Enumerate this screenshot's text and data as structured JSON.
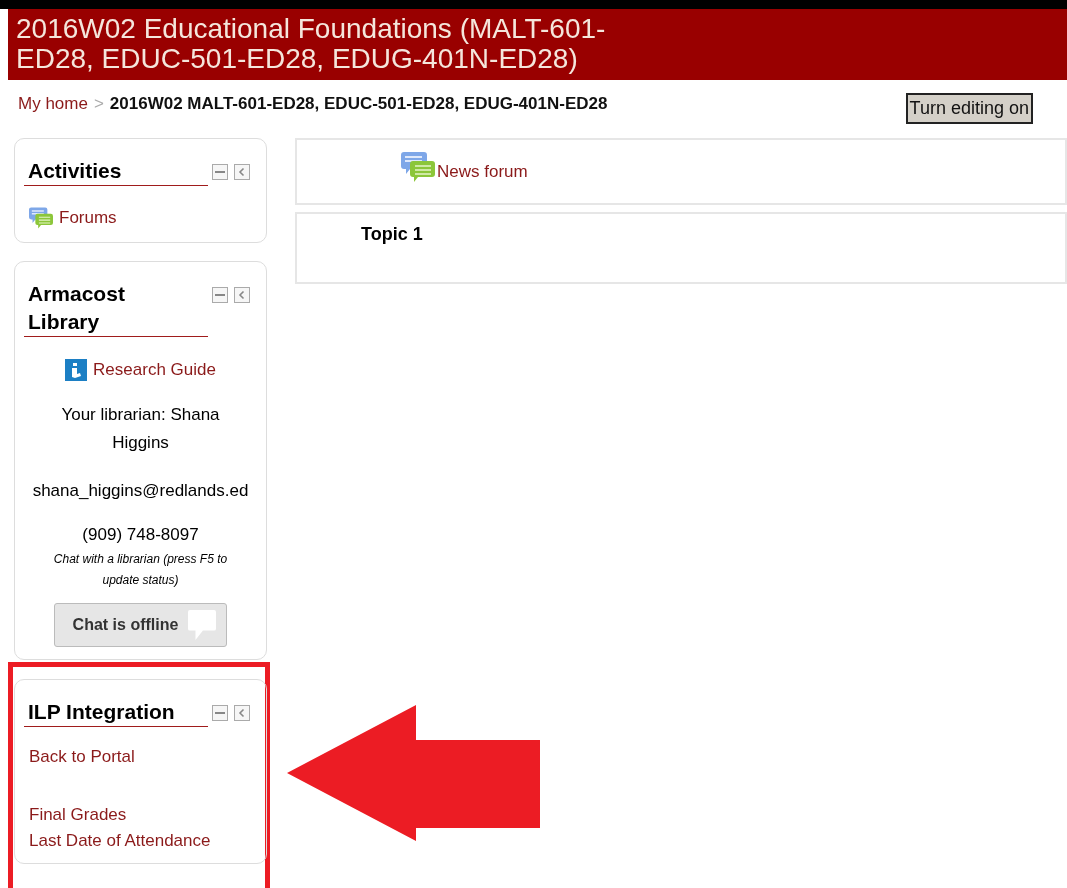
{
  "header": {
    "title": "2016W02 Educational Foundations (MALT-601-ED28, EDUC-501-ED28, EDUG-401N-ED28)"
  },
  "breadcrumb": [
    {
      "text": "My home",
      "kind": "link"
    },
    {
      "text": ">",
      "kind": "separator"
    },
    {
      "text": "2016W02 MALT-601-ED28, EDUC-501-ED28, EDUG-401N-ED28",
      "kind": "current"
    }
  ],
  "editing_button": {
    "label": "Turn editing on"
  },
  "blocks": [
    {
      "title": "Activities",
      "highlighted": false,
      "items": [
        {
          "kind": "forum-link",
          "text": "Forums"
        }
      ]
    },
    {
      "title": "Armacost Library",
      "highlighted": false,
      "items": [
        {
          "kind": "guide-link",
          "text": "Research Guide"
        },
        {
          "kind": "text",
          "text": "Your librarian: Shana Higgins"
        },
        {
          "kind": "text",
          "text": "shana_higgins@redlands.ed"
        },
        {
          "kind": "tight-text",
          "text": "(909) 748-8097"
        },
        {
          "kind": "note",
          "text": "Chat with a librarian (press F5 to update status)"
        },
        {
          "kind": "button",
          "text": "Chat is offline"
        }
      ]
    },
    {
      "title": "ILP Integration",
      "highlighted": true,
      "items": [
        {
          "kind": "link",
          "text": "Back to Portal"
        },
        {
          "kind": "spaced-link",
          "text": "Final Grades"
        },
        {
          "kind": "tight-link",
          "text": "Last Date of Attendance"
        }
      ]
    }
  ],
  "sections": [
    {
      "kind": "forum-activity",
      "text": "News forum"
    },
    {
      "kind": "topic",
      "text": "Topic 1"
    }
  ],
  "annotation": {
    "kind": "arrow"
  }
}
